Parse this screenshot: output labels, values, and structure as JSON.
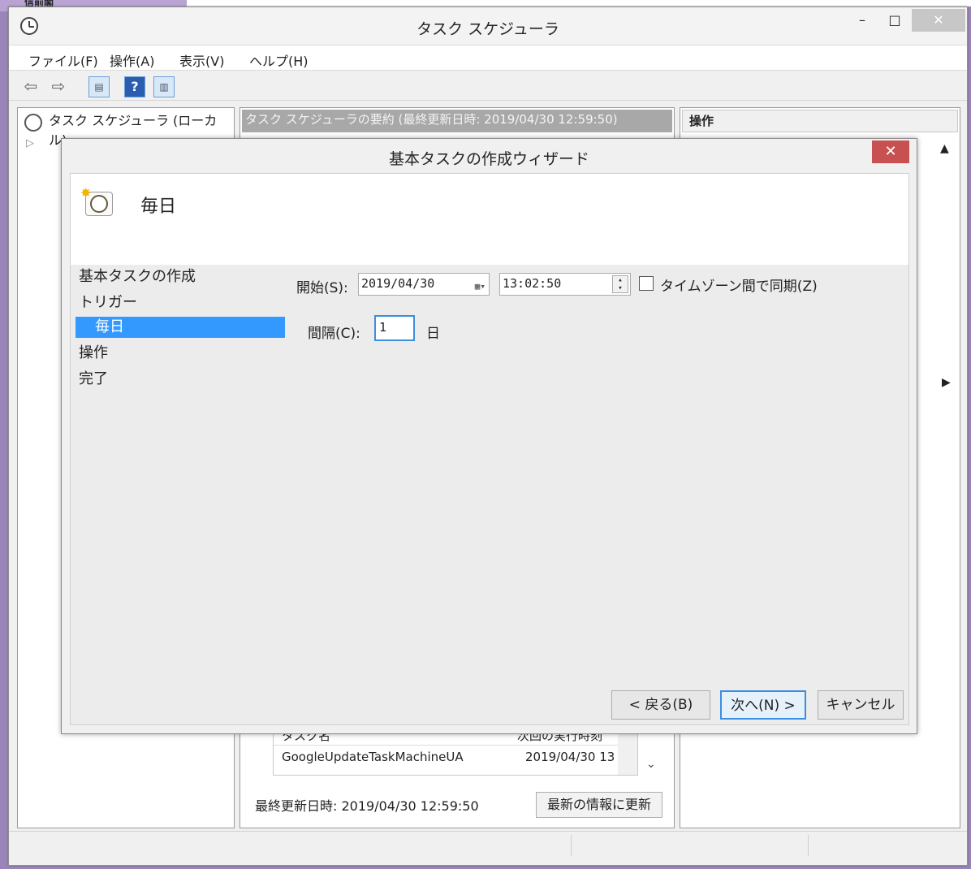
{
  "background": {
    "fragment_text": "信前閣"
  },
  "window": {
    "title": "タスク スケジューラ",
    "minimize": "–",
    "maximize": "□",
    "close": "✕"
  },
  "menu": [
    "ファイル(F)",
    "操作(A)",
    "表示(V)",
    "ヘルプ(H)"
  ],
  "toolbar": {
    "back": "⇦",
    "forward": "⇨",
    "help": "?"
  },
  "tree": {
    "root": "タスク スケジューラ (ローカル)",
    "child_partial": "▷"
  },
  "center": {
    "header": "タスク スケジューラの要約 (最終更新日時: 2019/04/30 12:59:50)",
    "table": {
      "col_name": "タスク名",
      "col_next": "次回の実行時刻",
      "row_name": "GoogleUpdateTaskMachineUA",
      "row_next": "2019/04/30 13"
    },
    "last_updated": "最終更新日時: 2019/04/30 12:59:50",
    "refresh_button": "最新の情報に更新"
  },
  "right_pane": {
    "header": "操作"
  },
  "dialog": {
    "title": "基本タスクの作成ウィザード",
    "close": "✕",
    "heading": "毎日",
    "steps": [
      "基本タスクの作成",
      "トリガー",
      "毎日",
      "操作",
      "完了"
    ],
    "start_label": "開始(S):",
    "start_date": "2019/04/30",
    "start_time": "13:02:50",
    "tz_sync_label": "タイムゾーン間で同期(Z)",
    "interval_label": "間隔(C):",
    "interval_value": "1",
    "interval_unit": "日",
    "back_button": "< 戻る(B)",
    "next_button": "次へ(N) >",
    "cancel_button": "キャンセル"
  },
  "colors": {
    "accent": "#3399ff",
    "close_red": "#c75050",
    "desktop": "#9a84b9"
  }
}
